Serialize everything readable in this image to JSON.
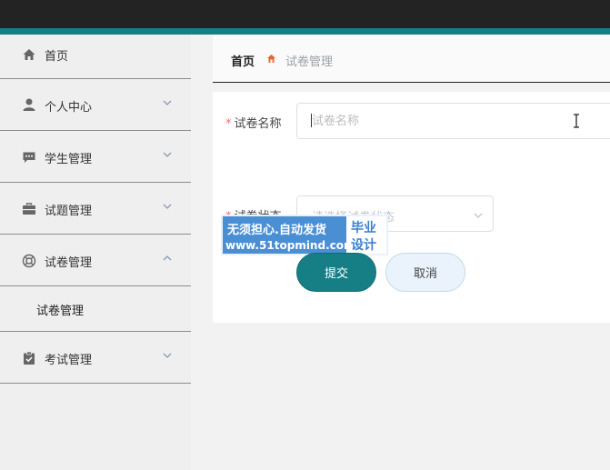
{
  "colors": {
    "topbar": "#232323",
    "accent": "#167f86",
    "required": "#f56c6c",
    "watermark_bg": "#4a8fd4"
  },
  "sidebar": {
    "items": [
      {
        "label": "首页",
        "icon": "home-icon"
      },
      {
        "label": "个人中心",
        "icon": "user-icon",
        "arrow": "chevron-down-icon"
      },
      {
        "label": "学生管理",
        "icon": "chat-icon",
        "arrow": "chevron-down-icon"
      },
      {
        "label": "试题管理",
        "icon": "briefcase-icon",
        "arrow": "chevron-down-icon"
      },
      {
        "label": "试卷管理",
        "icon": "lifebuoy-icon",
        "arrow": "chevron-up-icon",
        "expanded": true
      },
      {
        "label": "考试管理",
        "icon": "clipboard-icon",
        "arrow": "chevron-down-icon"
      }
    ],
    "submenu": [
      {
        "label": "试卷管理"
      }
    ]
  },
  "breadcrumb": {
    "home": "首页",
    "current": "试卷管理"
  },
  "form": {
    "name_label": "试卷名称",
    "name_placeholder": "试卷名称",
    "name_value": "",
    "status_label": "试卷状态",
    "status_placeholder": "请选择试卷状态",
    "required_mark": "*"
  },
  "buttons": {
    "submit": "提交",
    "cancel": "取消"
  },
  "watermark": {
    "line1": "无须担心.自动发货",
    "line2": "www.51topmind.com",
    "right_top": "毕业",
    "right_bottom": "设计"
  }
}
